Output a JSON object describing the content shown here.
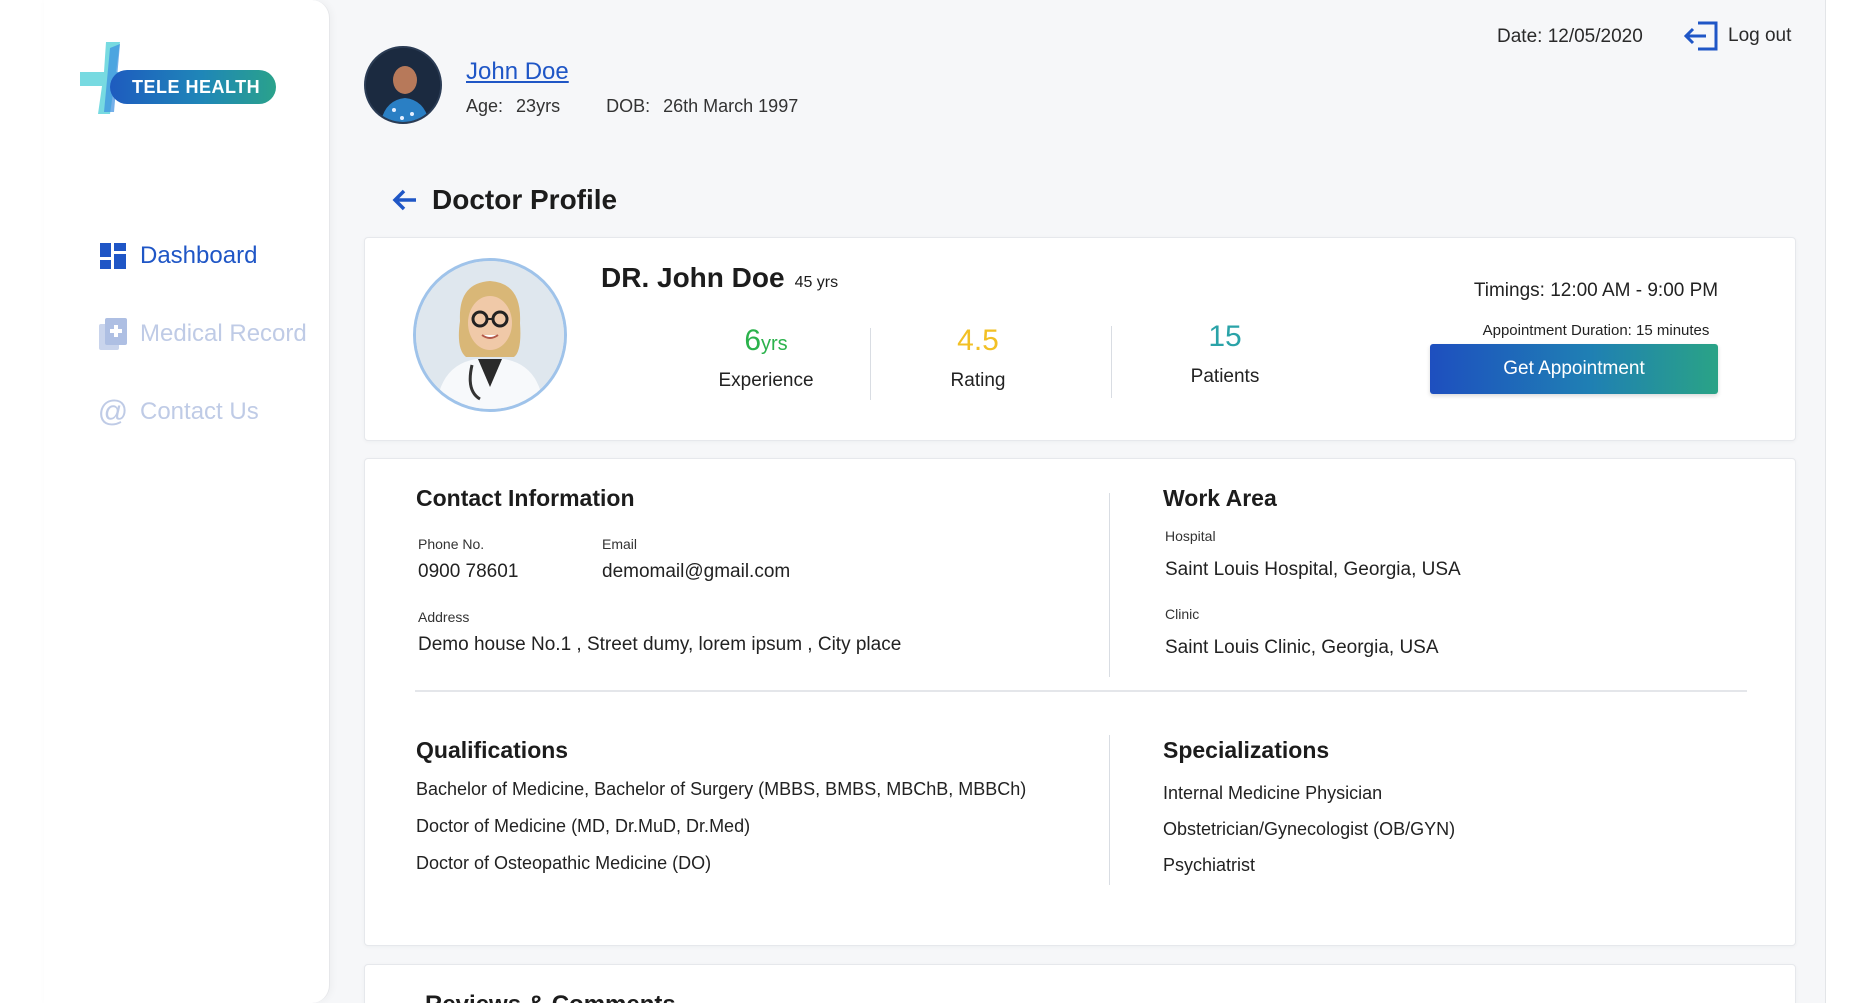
{
  "app": {
    "logo_text": "TELE HEALTH"
  },
  "sidebar": {
    "items": [
      {
        "label": "Dashboard",
        "icon": "dashboard-icon",
        "active": true
      },
      {
        "label": "Medical Record",
        "icon": "medical-record-icon",
        "active": false
      },
      {
        "label": "Contact Us",
        "icon": "at-icon",
        "active": false
      }
    ]
  },
  "header": {
    "user_name": "John Doe",
    "age_label": "Age:",
    "age_value": "23yrs",
    "dob_label": "DOB:",
    "dob_value": "26th March 1997",
    "date_text": "Date: 12/05/2020",
    "logout_label": "Log out"
  },
  "page": {
    "title": "Doctor Profile"
  },
  "doctor": {
    "name": "DR. John Doe",
    "age": "45 yrs",
    "experience_value": "6",
    "experience_unit": "yrs",
    "experience_label": "Experience",
    "rating_value": "4.5",
    "rating_label": "Rating",
    "patients_value": "15",
    "patients_label": "Patients",
    "timings": "Timings: 12:00 AM - 9:00 PM",
    "duration": "Appointment Duration: 15 minutes",
    "appointment_button": "Get Appointment"
  },
  "contact": {
    "title": "Contact Information",
    "phone_label": "Phone No.",
    "phone_value": "0900 78601",
    "email_label": "Email",
    "email_value": "demomail@gmail.com",
    "address_label": "Address",
    "address_value": "Demo house No.1 , Street dumy, lorem ipsum , City place"
  },
  "work": {
    "title": "Work Area",
    "hospital_label": "Hospital",
    "hospital_value": "Saint Louis Hospital, Georgia, USA",
    "clinic_label": "Clinic",
    "clinic_value": "Saint Louis Clinic, Georgia, USA"
  },
  "qualifications": {
    "title": "Qualifications",
    "items": [
      "Bachelor of Medicine, Bachelor of Surgery (MBBS, BMBS, MBChB, MBBCh)",
      "Doctor of Medicine (MD, Dr.MuD, Dr.Med)",
      "Doctor of Osteopathic Medicine (DO)"
    ]
  },
  "specializations": {
    "title": "Specializations",
    "items": [
      "Internal Medicine Physician",
      "Obstetrician/Gynecologist (OB/GYN)",
      "Psychiatrist"
    ]
  },
  "reviews": {
    "title": "Reviews & Comments"
  },
  "colors": {
    "primary_blue": "#1f56c6",
    "experience_green": "#2bb24c",
    "rating_yellow": "#f2c025",
    "patients_teal": "#2aa3a8",
    "inactive_nav": "#bfcbe6"
  }
}
